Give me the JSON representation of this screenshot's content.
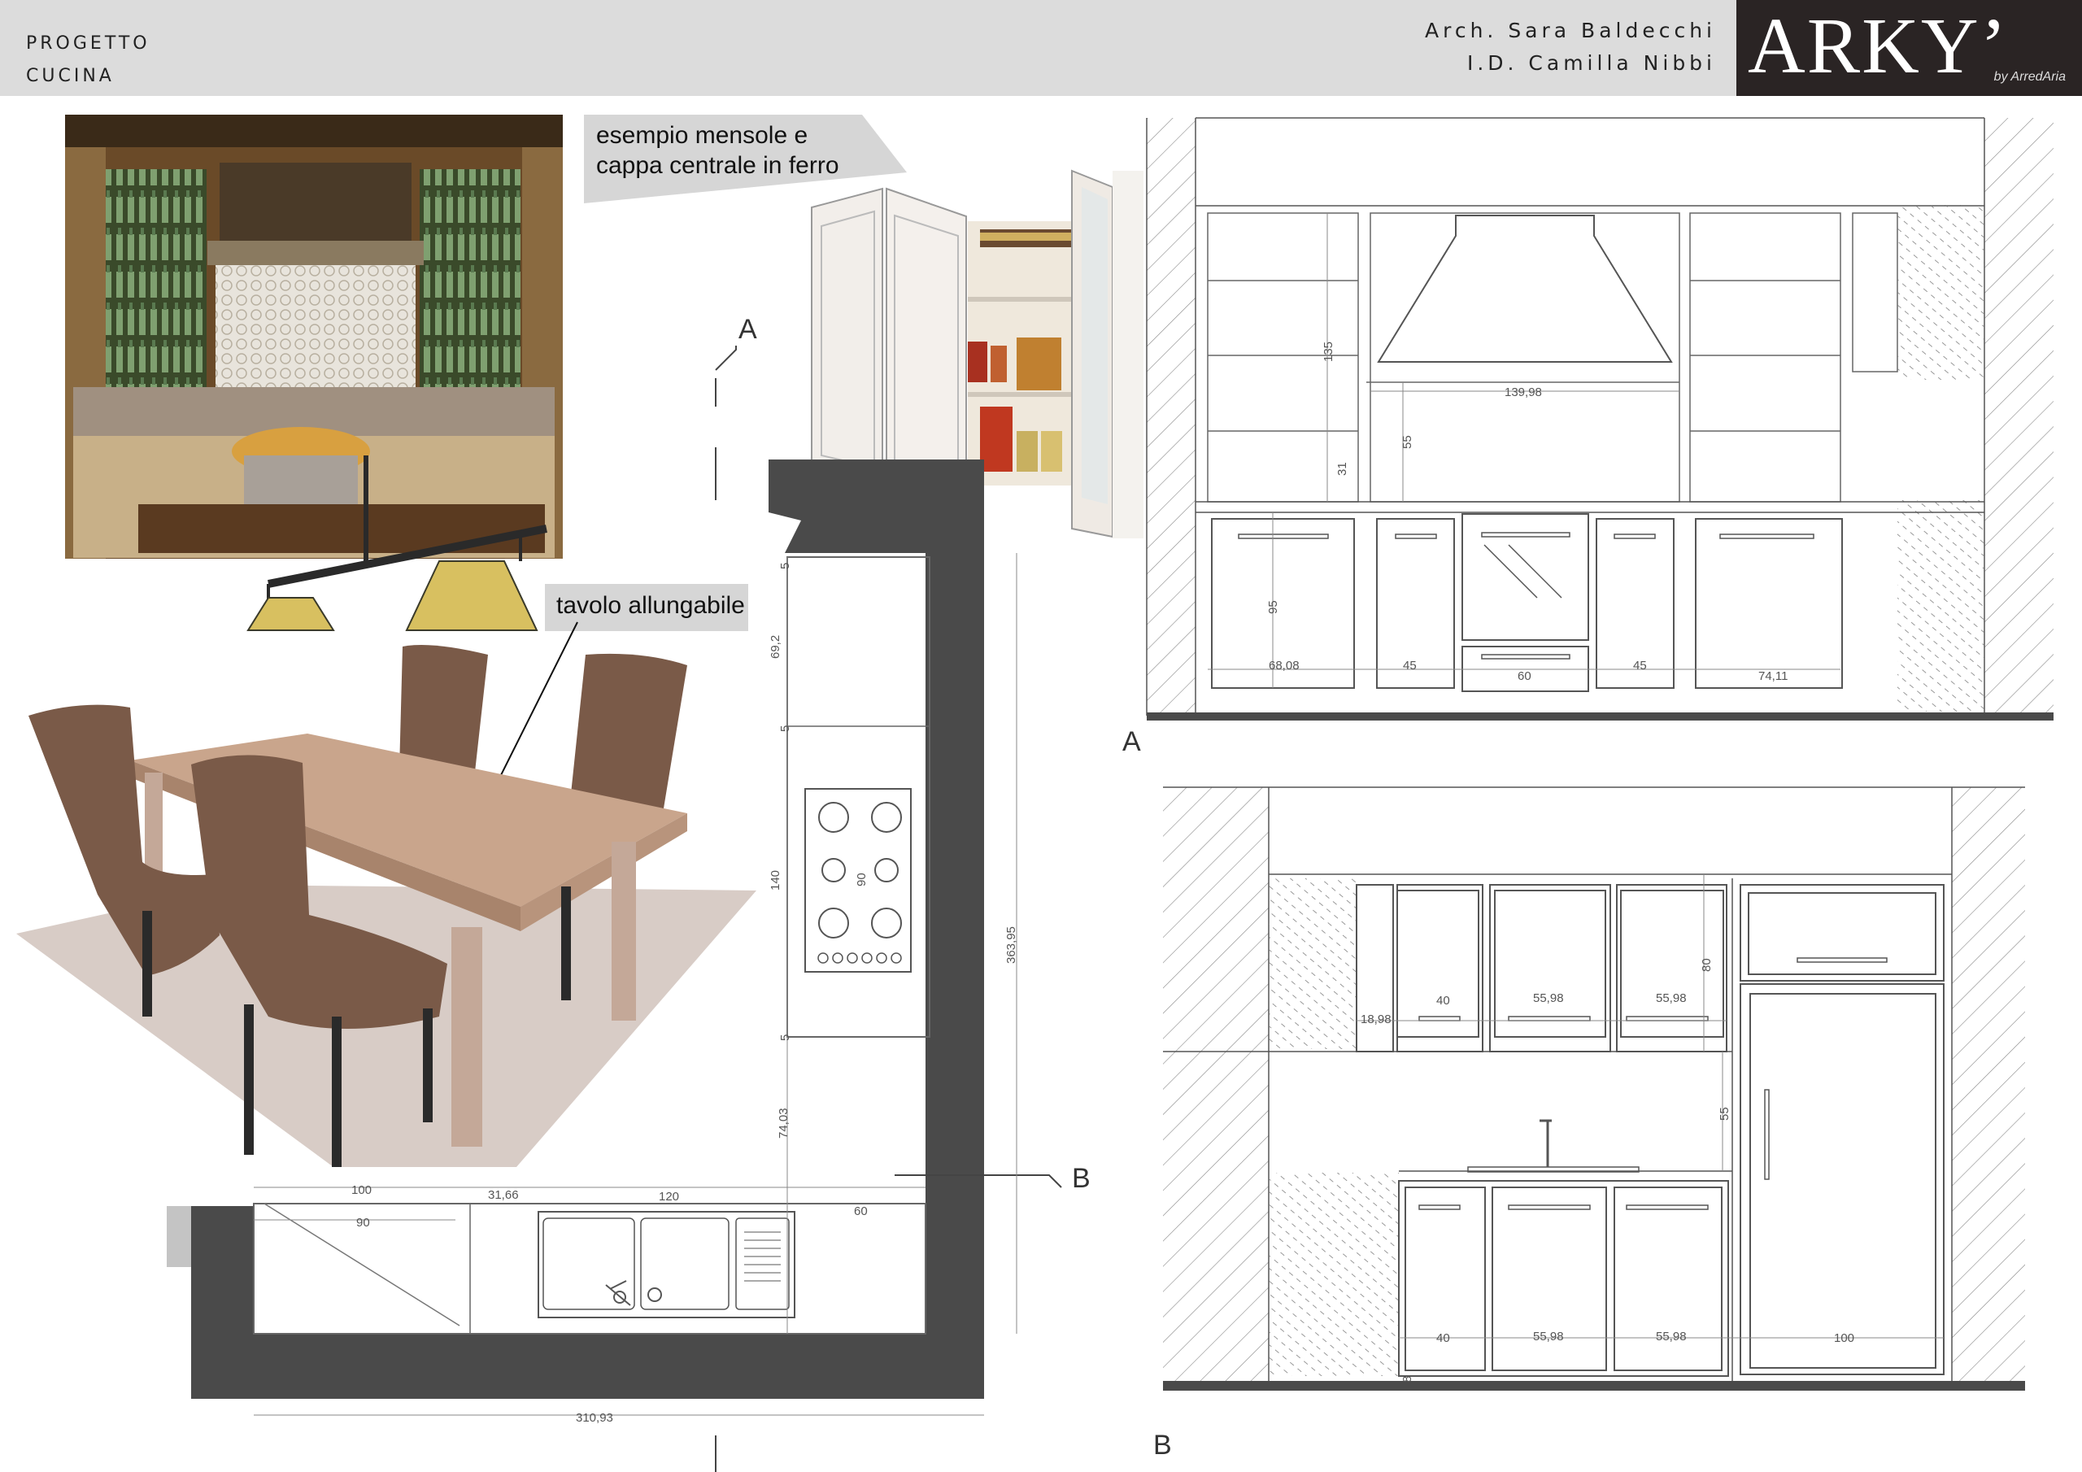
{
  "header": {
    "project_line1": "PROGETTO",
    "project_line2": "CUCINA",
    "architect": "Arch. Sara Baldecchi",
    "designer": "I.D. Camilla Nibbi",
    "logo_text": "ARKY’",
    "logo_sub": "by ArredAria"
  },
  "callouts": {
    "shelves_line1": "esempio mensole e",
    "shelves_line2": "cappa centrale in ferro",
    "table": "tavolo allungabile"
  },
  "section_labels": {
    "a_top": "A",
    "a_elev": "A",
    "b_plan": "B",
    "b_elev": "B"
  },
  "plan_dims": {
    "d5a": "5",
    "d69": "69,2",
    "d5b": "5",
    "d140": "140",
    "d90": "90",
    "d5c": "5",
    "d74": "74,03",
    "d363": "363,95",
    "d100": "100",
    "d90b": "90",
    "d31": "31,66",
    "d120": "120",
    "d60": "60",
    "d310": "310,93"
  },
  "elev_a_dims": {
    "d135": "135",
    "d139": "139,98",
    "d55": "55",
    "d31": "31",
    "d95": "95",
    "d68": "68,08",
    "d45a": "45",
    "d60": "60",
    "d45b": "45",
    "d74": "74,11"
  },
  "elev_b_dims": {
    "d80": "80",
    "d18": "18,98",
    "d40a": "40",
    "d55a": "55,98",
    "d55b": "55,98",
    "d55v": "55",
    "d40b": "40",
    "d55c": "55,98",
    "d55d": "55,98",
    "d100": "100",
    "d8": "8"
  },
  "colors": {
    "header_bg": "#dcdcdc",
    "logo_bg": "#2a2424",
    "wall": "#4a4a4a",
    "upholstery": "#7a5a48",
    "wood": "#c9a58c",
    "rug": "#d8ccc6",
    "callout_bg": "#d6d6d6"
  }
}
